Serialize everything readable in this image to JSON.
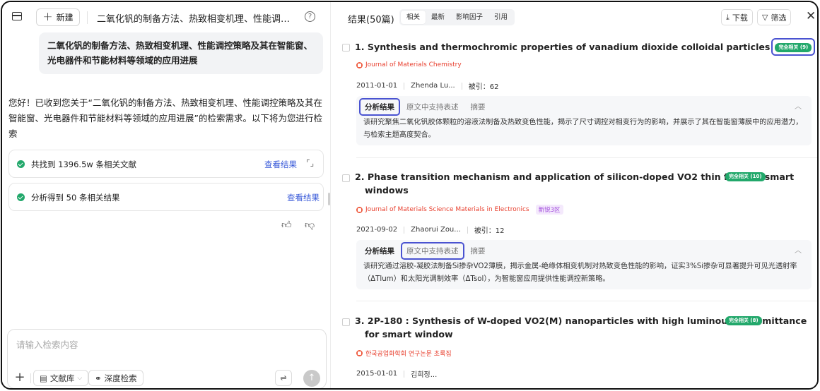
{
  "left": {
    "new_label": "新建",
    "conversation_title": "二氧化钒的制备方法、热致相变机理、性能调控策…",
    "help_glyph": "?",
    "user_query": "二氧化钒的制备方法、热致相变机理、性能调控策略及其在智能窗、光电器件和节能材料等领域的应用进展",
    "assistant_text": "您好！已收到您关于“二氧化钒的制备方法、热致相变机理、性能调控策略及其在智能窗、光电器件和节能材料等领域的应用进展”的检索需求。以下将为您进行检索",
    "step1_text": "共找到 1396.5w 条相关文献",
    "step1_link": "查看结果",
    "step2_text": "分析得到 50 条相关结果",
    "step2_link": "查看结果",
    "input_placeholder": "请输入检索内容",
    "library_label": "文献库",
    "deep_search_label": "深度检索"
  },
  "right": {
    "title": "结果(50篇)",
    "tabs": [
      "相关",
      "最新",
      "影响因子",
      "引用"
    ],
    "download_label": "下载",
    "filter_label": "筛选",
    "results": [
      {
        "title": "1. Synthesis and thermochromic properties of vanadium dioxide colloidal particles",
        "badge": "完全相关 (9)",
        "journal": "Journal of Materials Chemistry",
        "date": "2011-01-01",
        "authors": "Zhenda Lu...",
        "citations": "被引：62",
        "panel_tabs": [
          "分析结果",
          "原文中支持表述",
          "摘要"
        ],
        "analysis": "该研究聚焦二氧化钒胶体颗粒的溶液法制备及热致变色性能，揭示了尺寸调控对相变行为的影响，并展示了其在智能窗薄膜中的应用潜力，与检索主题高度契合。"
      },
      {
        "title_line1": "2. Phase transition mechanism and application of silicon-doped VO2 thin films to smart",
        "title_line2": "windows",
        "badge": "完全相关 (10)",
        "journal": "Journal of Materials Science Materials in Electronics",
        "zone": "新锐3区",
        "date": "2021-09-02",
        "authors": "Zhaorui Zou...",
        "citations": "被引：12",
        "panel_tabs": [
          "分析结果",
          "原文中支持表述",
          "摘要"
        ],
        "analysis": "该研究通过溶胶-凝胶法制备Si掺杂VO2薄膜，揭示金属-绝缘体相变机制对热致变色性能的影响，证实3%Si掺杂可显著提升可见光透射率（ΔTlum）和太阳光调制效率（ΔTsol），为智能窗应用提供性能调控新策略。"
      },
      {
        "title_line1": "3. 2P-180 : Synthesis of W-doped VO2(M) nanoparticles with high luminous transmittance",
        "title_line2": "for smart window",
        "badge": "完全相关 (8)",
        "journal": "한국공업화학회 연구논문 초록집",
        "date": "2015-01-01",
        "authors": "김희정..."
      }
    ]
  },
  "colors": {
    "accent": "#3a5bd9",
    "badge": "#22a86b",
    "highlight": "#4a53d1",
    "journal": "#e8402f"
  }
}
